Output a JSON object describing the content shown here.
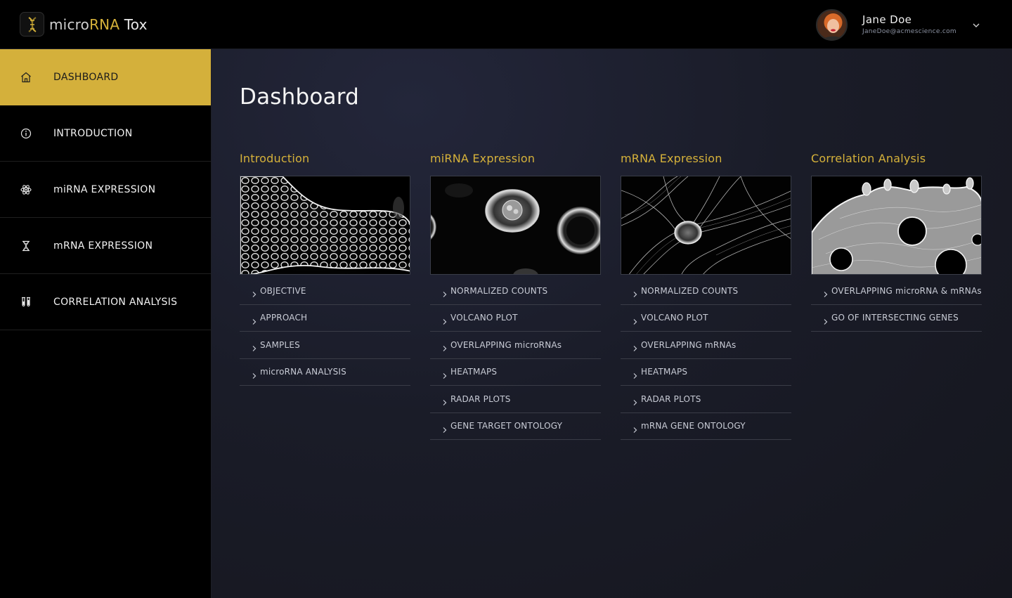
{
  "app": {
    "brand_part1": "micro",
    "brand_part2": "RNA",
    "brand_part3": " Tox",
    "logo_icon": "dna-icon",
    "accent_color": "#d4b03b"
  },
  "user": {
    "name": "Jane Doe",
    "email": "JaneDoe@acmescience.com",
    "menu_icon": "chevron-down-icon"
  },
  "sidebar": {
    "items": [
      {
        "label": "DASHBOARD",
        "icon": "home-icon",
        "active": true
      },
      {
        "label": "INTRODUCTION",
        "icon": "info-icon",
        "active": false
      },
      {
        "label": "miRNA EXPRESSION",
        "icon": "atom-icon",
        "active": false
      },
      {
        "label": "mRNA EXPRESSION",
        "icon": "hourglass-icon",
        "active": false
      },
      {
        "label": "CORRELATION ANALYSIS",
        "icon": "test-tubes-icon",
        "active": false
      }
    ]
  },
  "main": {
    "title": "Dashboard",
    "sections": [
      {
        "title": "Introduction",
        "links": [
          "OBJECTIVE",
          "APPROACH",
          "SAMPLES",
          "microRNA ANALYSIS"
        ]
      },
      {
        "title": "miRNA Expression",
        "links": [
          "NORMALIZED COUNTS",
          "VOLCANO PLOT",
          "OVERLAPPING microRNAs",
          "HEATMAPS",
          "RADAR PLOTS",
          "GENE TARGET ONTOLOGY"
        ]
      },
      {
        "title": "mRNA Expression",
        "links": [
          "NORMALIZED COUNTS",
          "VOLCANO PLOT",
          "OVERLAPPING mRNAs",
          "HEATMAPS",
          "RADAR PLOTS",
          "mRNA GENE ONTOLOGY"
        ]
      },
      {
        "title": "Correlation Analysis",
        "links": [
          "OVERLAPPING microRNA & mRNAs",
          "GO OF INTERSECTING GENES"
        ]
      }
    ]
  }
}
